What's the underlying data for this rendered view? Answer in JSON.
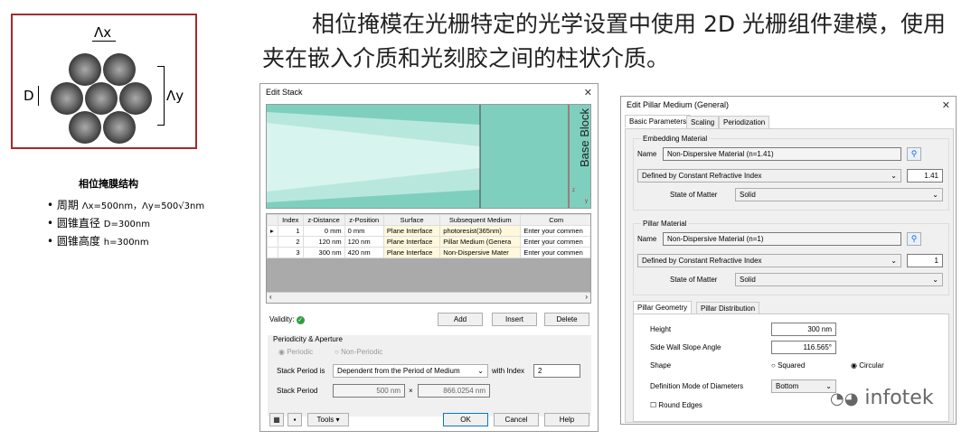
{
  "left": {
    "lambda_x": "Λx",
    "lambda_y": "Λy",
    "d_label": "D",
    "caption": "相位掩膜结构",
    "bullets": [
      {
        "prefix": "周期",
        "text": "Λx=500nm，Λy=500√3nm"
      },
      {
        "prefix": "圆锥直径",
        "text": "D=300nm"
      },
      {
        "prefix": "圆锥高度",
        "text": "h=300nm"
      }
    ]
  },
  "headline": "相位掩模在光栅特定的光学设置中使用 2D 光栅组件建模，使用夹在嵌入介质和光刻胶之间的柱状介质。",
  "edit_stack": {
    "title": "Edit Stack",
    "close": "✕",
    "base_block": "Base Block",
    "axis_z": "z",
    "axis_y": "y",
    "columns": [
      "Index",
      "z-Distance",
      "z-Position",
      "Surface",
      "Subsequent Medium",
      "Com"
    ],
    "rows": [
      [
        "1",
        "0 mm",
        "0 mm",
        "Plane Interface",
        "photoresist(365nm)",
        "Enter your commen"
      ],
      [
        "2",
        "120 nm",
        "120 nm",
        "Plane Interface",
        "Pillar Medium (Genera",
        "Enter your commen"
      ],
      [
        "3",
        "300 nm",
        "420 nm",
        "Plane Interface",
        "Non-Dispersive Mater",
        "Enter your commen"
      ]
    ],
    "validity": "Validity:",
    "add": "Add",
    "insert": "Insert",
    "delete": "Delete",
    "periodicity_title": "Periodicity & Aperture",
    "periodic": "Periodic",
    "non_periodic": "Non-Periodic",
    "stack_period_is": "Stack Period is",
    "stack_period_mode": "Dependent from the Period of Medium",
    "with_index": "with Index",
    "index_value": "2",
    "stack_period": "Stack Period",
    "period_x": "500 nm",
    "times": "×",
    "period_y": "866.0254 nm",
    "tools": "Tools",
    "ok": "OK",
    "cancel": "Cancel",
    "help": "Help"
  },
  "edit_pillar": {
    "title": "Edit Pillar Medium (General)",
    "close": "✕",
    "tabs": [
      "Basic Parameters",
      "Scaling",
      "Periodization"
    ],
    "embedding_title": "Embedding Material",
    "name_label": "Name",
    "embedding_name": "Non-Dispersive Material (n=1.41)",
    "embedding_def": "Defined by Constant Refractive Index",
    "embedding_index": "1.41",
    "state_label": "State of Matter",
    "state_value": "Solid",
    "pillar_title": "Pillar Material",
    "pillar_name": "Non-Dispersive Material (n=1)",
    "pillar_def": "Defined by Constant Refractive Index",
    "pillar_index": "1",
    "pillar_state": "Solid",
    "geo_tabs": [
      "Pillar Geometry",
      "Pillar Distribution"
    ],
    "height_label": "Height",
    "height_value": "300 nm",
    "slope_label": "Side Wall Slope Angle",
    "slope_value": "116.565°",
    "shape_label": "Shape",
    "shape_squared": "Squared",
    "shape_circular": "Circular",
    "diam_label": "Definition Mode of Diameters",
    "diam_value": "Bottom",
    "round_edges": "Round Edges"
  },
  "watermark": "infotek",
  "colors": {
    "frame": "#a52a2a",
    "teal": "#7fcfbf",
    "teal_dark": "#5fb9a6",
    "panel": "#f0f0f0",
    "accent": "#0078d7"
  }
}
